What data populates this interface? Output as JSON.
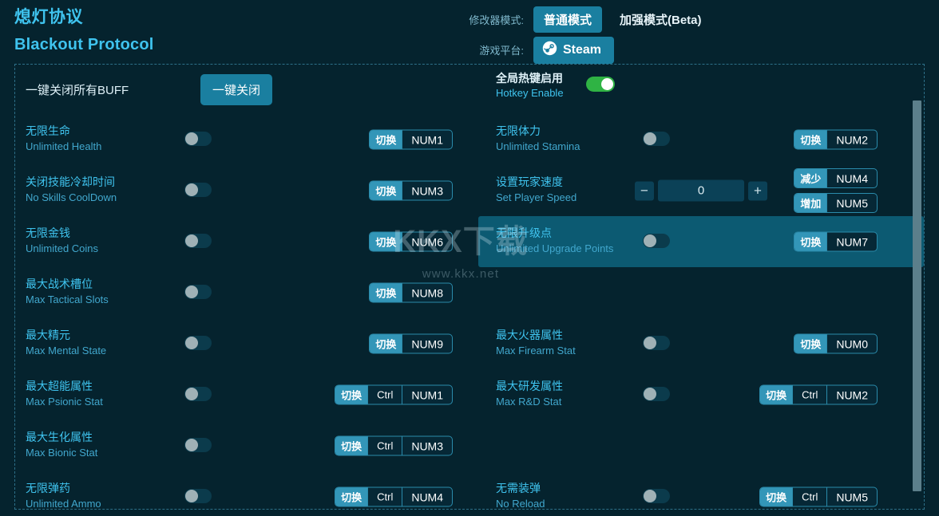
{
  "app": {
    "title_cn": "熄灯协议",
    "title_en": "Blackout Protocol"
  },
  "header": {
    "mode_label": "修改器模式:",
    "mode_normal": "普通模式",
    "mode_enhanced": "加强模式(Beta)",
    "platform_label": "游戏平台:",
    "platform_value": "Steam",
    "platform_icon": "steam-icon"
  },
  "toolbar": {
    "all_buff_label": "一键关闭所有BUFF",
    "close_all_button": "一键关闭",
    "hotkey_cn": "全局热键启用",
    "hotkey_en": "Hotkey Enable",
    "hotkey_enabled": true
  },
  "watermark": {
    "main": "KKX下载",
    "sub": "www.kkx.net"
  },
  "rows": [
    {
      "left": {
        "cn": "无限生命",
        "en": "Unlimited Health",
        "control": "toggle",
        "on": false,
        "keys": [
          {
            "action": "切换",
            "combo": [
              "NUM1"
            ]
          }
        ]
      },
      "right": {
        "cn": "无限体力",
        "en": "Unlimited Stamina",
        "control": "toggle",
        "on": false,
        "keys": [
          {
            "action": "切换",
            "combo": [
              "NUM2"
            ]
          }
        ]
      }
    },
    {
      "left": {
        "cn": "关闭技能冷却时间",
        "en": "No Skills CoolDown",
        "control": "toggle",
        "on": false,
        "keys": [
          {
            "action": "切换",
            "combo": [
              "NUM3"
            ]
          }
        ]
      },
      "right": {
        "cn": "设置玩家速度",
        "en": "Set Player Speed",
        "control": "spinner",
        "value": "0",
        "minus": "−",
        "plus": "+",
        "keys": [
          {
            "action": "减少",
            "combo": [
              "NUM4"
            ]
          },
          {
            "action": "增加",
            "combo": [
              "NUM5"
            ]
          }
        ]
      }
    },
    {
      "left": {
        "cn": "无限金钱",
        "en": "Unlimited Coins",
        "control": "toggle",
        "on": false,
        "keys": [
          {
            "action": "切换",
            "combo": [
              "NUM6"
            ]
          }
        ]
      },
      "right": {
        "cn": "无限升级点",
        "en": "Unlimited Upgrade Points",
        "control": "toggle",
        "on": false,
        "highlight": true,
        "keys": [
          {
            "action": "切换",
            "combo": [
              "NUM7"
            ]
          }
        ]
      }
    },
    {
      "left": {
        "cn": "最大战术槽位",
        "en": "Max Tactical Slots",
        "control": "toggle",
        "on": false,
        "keys": [
          {
            "action": "切换",
            "combo": [
              "NUM8"
            ]
          }
        ]
      },
      "right": null
    },
    {
      "left": {
        "cn": "最大精元",
        "en": "Max Mental State",
        "control": "toggle",
        "on": false,
        "keys": [
          {
            "action": "切换",
            "combo": [
              "NUM9"
            ]
          }
        ]
      },
      "right": {
        "cn": "最大火器属性",
        "en": "Max Firearm Stat",
        "control": "toggle",
        "on": false,
        "keys": [
          {
            "action": "切换",
            "combo": [
              "NUM0"
            ]
          }
        ]
      }
    },
    {
      "left": {
        "cn": "最大超能属性",
        "en": "Max Psionic Stat",
        "control": "toggle",
        "on": false,
        "keys": [
          {
            "action": "切换",
            "combo": [
              "Ctrl",
              "NUM1"
            ]
          }
        ]
      },
      "right": {
        "cn": "最大研发属性",
        "en": "Max R&D Stat",
        "control": "toggle",
        "on": false,
        "keys": [
          {
            "action": "切换",
            "combo": [
              "Ctrl",
              "NUM2"
            ]
          }
        ]
      }
    },
    {
      "left": {
        "cn": "最大生化属性",
        "en": "Max Bionic Stat",
        "control": "toggle",
        "on": false,
        "keys": [
          {
            "action": "切换",
            "combo": [
              "Ctrl",
              "NUM3"
            ]
          }
        ]
      },
      "right": null
    },
    {
      "left": {
        "cn": "无限弹药",
        "en": "Unlimited Ammo",
        "control": "toggle",
        "on": false,
        "keys": [
          {
            "action": "切换",
            "combo": [
              "Ctrl",
              "NUM4"
            ]
          }
        ]
      },
      "right": {
        "cn": "无需装弹",
        "en": "No Reload",
        "control": "toggle",
        "on": false,
        "keys": [
          {
            "action": "切换",
            "combo": [
              "Ctrl",
              "NUM5"
            ]
          }
        ]
      }
    }
  ],
  "colors": {
    "background": "#05232e",
    "accent": "#3fc3ee",
    "button": "#1a7fa0",
    "badge": "#3396b8",
    "highlight_row": "#0c5a72",
    "toggle_on": "#2fb344",
    "scrollbar": "#5c7f8b"
  }
}
